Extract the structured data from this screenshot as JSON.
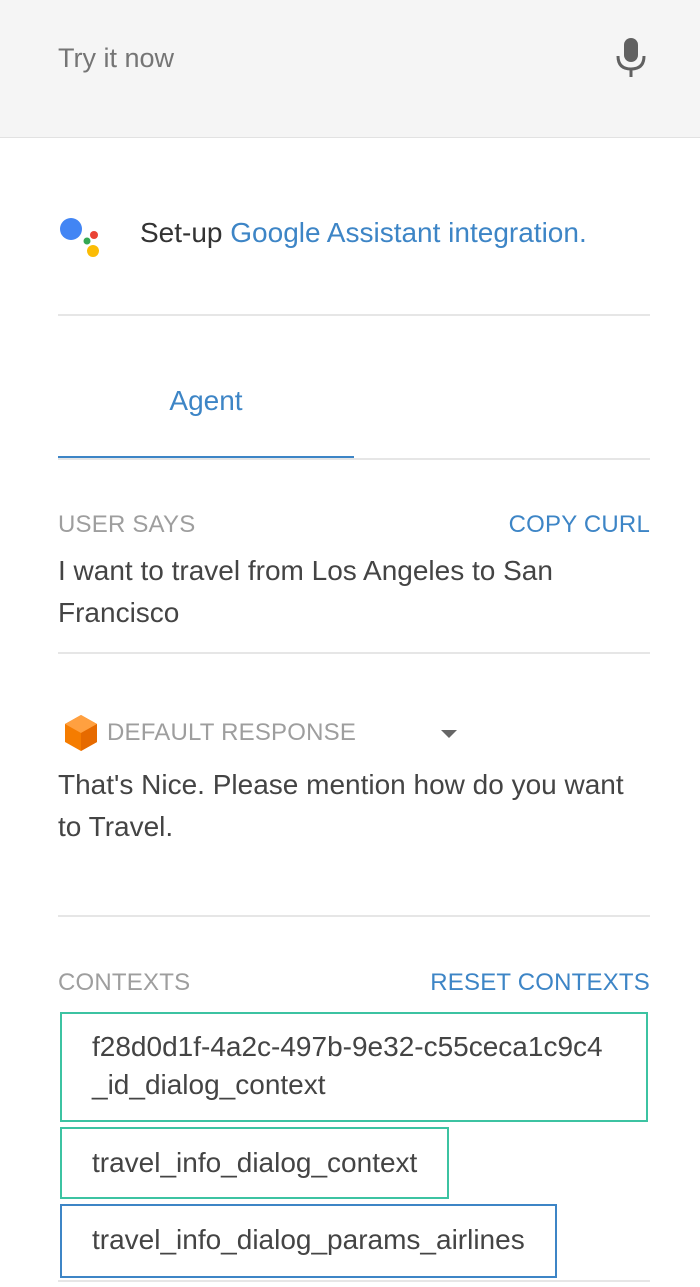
{
  "top": {
    "input_placeholder": "Try it now",
    "mic_icon": "microphone-icon"
  },
  "assistant": {
    "prefix": "Set-up ",
    "link": "Google Assistant integration.",
    "logo_icon": "google-assistant-icon",
    "logo_colors": [
      "#4285f4",
      "#ea4335",
      "#fbbc05",
      "#34a853"
    ]
  },
  "tabs": [
    {
      "label": "Agent",
      "active": true
    }
  ],
  "user_says": {
    "label": "USER SAYS",
    "action": "COPY CURL",
    "text": "I want to travel from Los Angeles to San Francisco"
  },
  "response": {
    "icon": "agent-cube-icon",
    "label": "DEFAULT RESPONSE",
    "dropdown_icon": "caret-down-icon",
    "text": "That's Nice. Please mention how do you want to Travel."
  },
  "contexts": {
    "label": "CONTEXTS",
    "action": "RESET CONTEXTS",
    "items": [
      "f28d0d1f-4a2c-497b-9e32-c55ceca1c9c4_id_dialog_context",
      "travel_info_dialog_context",
      "travel_info_dialog_params_airlines"
    ]
  },
  "colors": {
    "accent": "#3d85c6",
    "context_green": "#3cc3a2",
    "cube_orange": "#f57c00"
  }
}
